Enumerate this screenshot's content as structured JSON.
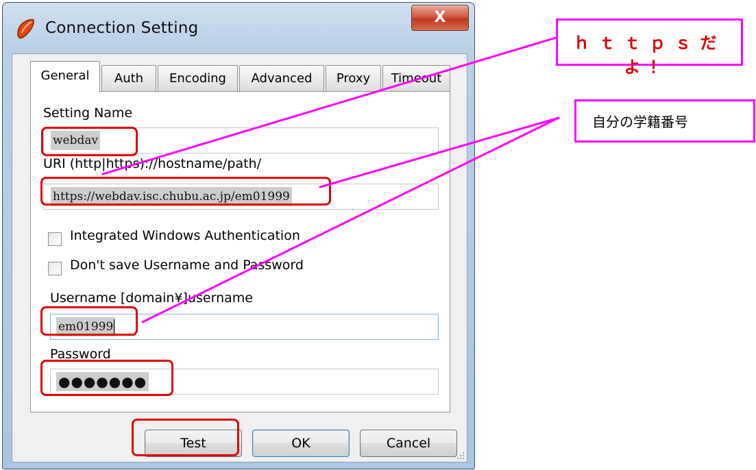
{
  "window": {
    "title": "Connection Setting",
    "close_glyph": "X"
  },
  "tabs": [
    {
      "label": "General",
      "active": true
    },
    {
      "label": "Auth",
      "active": false
    },
    {
      "label": "Encoding",
      "active": false
    },
    {
      "label": "Advanced",
      "active": false
    },
    {
      "label": "Proxy",
      "active": false
    },
    {
      "label": "Timeout",
      "active": false
    }
  ],
  "form": {
    "setting_name_label": "Setting Name",
    "setting_name_value": "webdav",
    "uri_label": "URI  (http|https)://hostname/path/",
    "uri_value": "https://webdav.isc.chubu.ac.jp/em01999",
    "integrated_auth_label": "Integrated Windows Authentication",
    "integrated_auth_checked": false,
    "dont_save_label": "Don't save Username and Password",
    "dont_save_checked": false,
    "username_label": "Username  [domain¥]username",
    "username_value": "em01999",
    "password_label": "Password",
    "password_value": "●●●●●●●"
  },
  "buttons": {
    "test": "Test",
    "ok": "OK",
    "cancel": "Cancel"
  },
  "annotations": {
    "https_note": "ｈｔｔｐｓだよ！",
    "student_id_note": "自分の学籍番号"
  },
  "colors": {
    "annotation_highlight": "#e30000",
    "callout_border": "#ff00ff",
    "https_note_text": "#e00000"
  }
}
